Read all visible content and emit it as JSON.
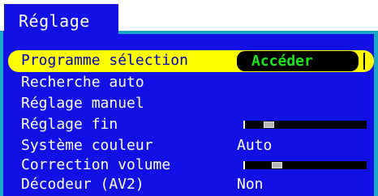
{
  "title": "Réglage",
  "menu": {
    "selected": {
      "label": "Programme sélection",
      "action_label": "Accéder"
    },
    "items": [
      {
        "label": "Recherche auto"
      },
      {
        "label": "Réglage manuel"
      },
      {
        "label": "Réglage fin",
        "slider_level": 0.17
      },
      {
        "label": "Système couleur",
        "value": "Auto"
      },
      {
        "label": "Correction volume",
        "slider_level": 0.24
      },
      {
        "label": "Décodeur (AV2)",
        "value": "Non"
      }
    ]
  },
  "colors": {
    "panel": "#1111e6",
    "border": "#19a8c8",
    "highlight": "#ffff00",
    "action_text": "#18e818"
  }
}
